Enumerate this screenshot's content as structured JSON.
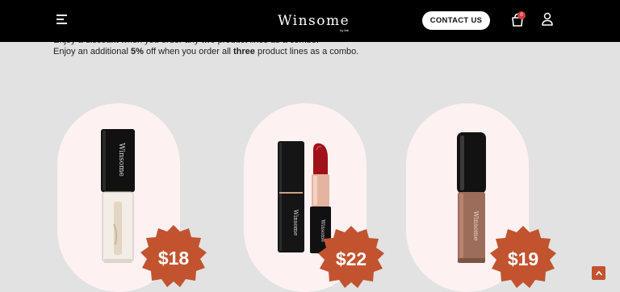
{
  "header": {
    "logo_text": "Winsome",
    "logo_sub": "by fab",
    "contact_label": "CONTACT US",
    "cart_count": "0"
  },
  "promo": {
    "cut_line": "Enjoy a discount when you order any two product lines as a combo.",
    "combo_prefix": "Enjoy an additional ",
    "combo_percent": "5%",
    "combo_middle": " off when you order all ",
    "combo_three": "three",
    "combo_suffix": " product lines as a combo."
  },
  "products": [
    {
      "name": "lip gloss",
      "price": "$18",
      "brand_mark": "Winsome"
    },
    {
      "name": "lipstick",
      "price": "$22",
      "brand_mark": "Winsome"
    },
    {
      "name": "liquid lipstick",
      "price": "$19",
      "brand_mark": "Winsome"
    }
  ],
  "colors": {
    "header_bg": "#000000",
    "page_bg": "#e2e2e2",
    "card_bg": "#fdf1f2",
    "badge": "#c2532f",
    "cart_badge": "#d23b3b"
  },
  "icons": [
    "menu-icon",
    "cart-icon",
    "user-icon",
    "arrow-up-icon"
  ]
}
